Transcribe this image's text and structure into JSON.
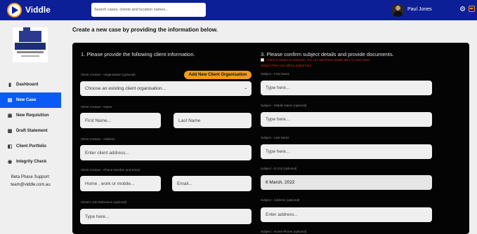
{
  "app": {
    "name": "Viddle"
  },
  "search": {
    "placeholder": "Search cases, clients and location names..."
  },
  "user": {
    "name": "Paul Jones"
  },
  "colors": {
    "topbar": "#0d1f96",
    "active_nav": "#0a5af5",
    "accent": "#f39a1b",
    "warning": "#d2281d"
  },
  "sidebar": {
    "items": [
      {
        "label": "Dashboard",
        "icon": "dashboard-icon"
      },
      {
        "label": "New Case",
        "icon": "new-case-icon",
        "active": true
      },
      {
        "label": "New Requisition",
        "icon": "requisition-icon"
      },
      {
        "label": "Draft Statement",
        "icon": "draft-icon"
      },
      {
        "label": "Client Portfolio",
        "icon": "portfolio-icon"
      },
      {
        "label": "Integrity Check",
        "icon": "integrity-icon"
      }
    ],
    "support_title": "Beta Phase Support:",
    "support_email": "team@viddle.com.au"
  },
  "main": {
    "title": "Create a new case by providing the information below.",
    "section1": {
      "title": "1. Please provide the following client information.",
      "org_label": "Client Contact - Organisation (optional)",
      "add_org_button": "Add New Client Organisation",
      "org_select": "Choose an existing client organisation...",
      "name_label": "Client Contact - Name",
      "first_name_placeholder": "First Name...",
      "last_name_placeholder": "Last Name",
      "address_label": "Client Contact - Address",
      "address_placeholder": "Enter client address...",
      "phone_email_label": "Client Contact - Phone Number and Email",
      "phone_placeholder": "Home , work or mobile...",
      "email_placeholder": "Email...",
      "job_ref_label": "Client's Job Reference (optional)",
      "job_ref_placeholder": "Type here..."
    },
    "section3": {
      "title": "3. Please confirm subject details and provide documents.",
      "unknown_note": "Check if subject is unknown. You can add these details later in Case View.",
      "files_note": "Subject Files can still be added here.",
      "first_name_label": "Subject - First Name",
      "first_name_placeholder": "Type here...",
      "middle_name_label": "Subject - Middle Name (optional)",
      "middle_name_placeholder": "Type here...",
      "last_name_label": "Subject - Last Name",
      "last_name_placeholder": "Type here...",
      "dob_label": "Subject - D.O.B (optional)",
      "dob_value": "6 March, 2022",
      "address_label": "Subject - Address (optional)",
      "address_placeholder": "Enter address...",
      "home_phone_label": "Subject - Home Phone (optional)"
    }
  }
}
